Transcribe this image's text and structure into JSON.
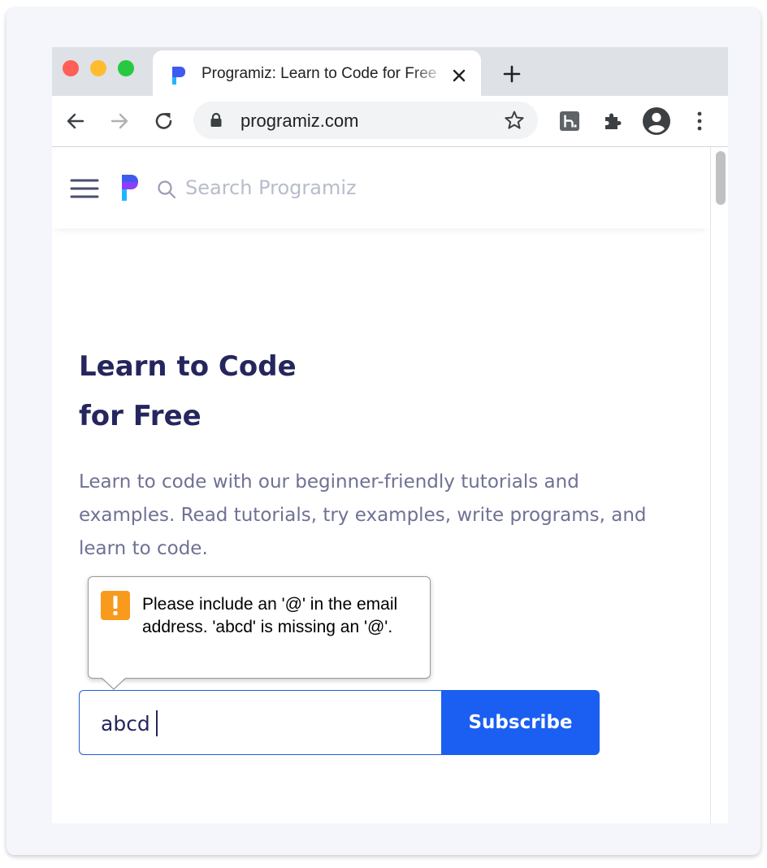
{
  "browser": {
    "tab": {
      "title": "Programiz: Learn to Code for Free"
    },
    "omnibox": {
      "url": "programiz.com"
    },
    "icons": {
      "back": "arrow-left-icon",
      "forward": "arrow-right-icon",
      "reload": "reload-icon",
      "lock": "lock-icon",
      "bookmark": "star-icon",
      "extension_h": "h-extension-icon",
      "extensions": "puzzle-icon",
      "profile": "profile-icon",
      "menu": "kebab-menu-icon"
    }
  },
  "site": {
    "search": {
      "placeholder": "Search Programiz"
    },
    "hero": {
      "title_line_1": "Learn to Code",
      "title_line_2": "for Free",
      "description": "Learn to code with our beginner-friendly tutorials and examples. Read tutorials, try examples, write programs, and learn to code."
    },
    "subscribe": {
      "email_value": "abcd",
      "button_label": "Subscribe"
    },
    "validation_tooltip": {
      "message": "Please include an '@' in the email address. 'abcd' is missing an '@'."
    }
  },
  "colors": {
    "heading": "#25265e",
    "body_text": "#6f7194",
    "primary_button": "#1a5ff2",
    "warning": "#f89a1c"
  }
}
